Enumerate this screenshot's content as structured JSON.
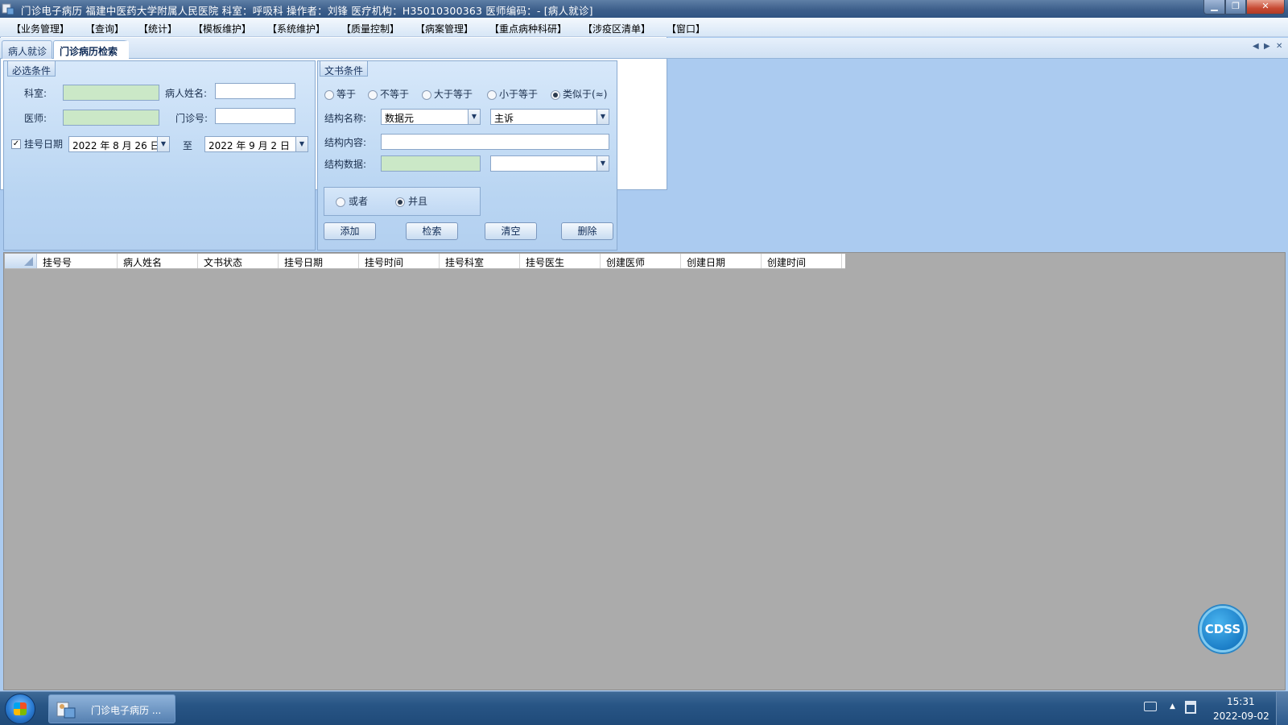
{
  "window": {
    "title": "门诊电子病历  福建中医药大学附属人民医院  科室：呼吸科  操作者：刘锋  医疗机构：H35010300363  医师编码：- [病人就诊]",
    "minimize": "▁",
    "maximize": "❐",
    "close": "✕"
  },
  "menu": [
    "【业务管理】",
    "【查询】",
    "【统计】",
    "【模板维护】",
    "【系统维护】",
    "【质量控制】",
    "【病案管理】",
    "【重点病种科研】",
    "【涉疫区清单】",
    "【窗口】"
  ],
  "tabs": {
    "items": [
      "病人就诊",
      "门诊病历检索"
    ],
    "active": "门诊病历检索",
    "ctrl_prev": "◀",
    "ctrl_next": "▶",
    "ctrl_close": "✕"
  },
  "required": {
    "title": "必选条件",
    "dept_label": "科室:",
    "dept_value": "",
    "patient_label": "病人姓名:",
    "patient_value": "",
    "doctor_label": "医师:",
    "doctor_value": "",
    "outpatient_label": "门诊号:",
    "outpatient_value": "",
    "reg_date_label": "挂号日期",
    "reg_date_checked": true,
    "date_from": "2022 年 8 月 26 日",
    "to_label": "至",
    "date_to": "2022 年 9 月 2 日"
  },
  "doc": {
    "title": "文书条件",
    "operators": [
      {
        "label": "等于",
        "checked": false
      },
      {
        "label": "不等于",
        "checked": false
      },
      {
        "label": "大于等于",
        "checked": false
      },
      {
        "label": "小于等于",
        "checked": false
      },
      {
        "label": "类似于(≈)",
        "checked": true
      }
    ],
    "struct_name_label": "结构名称:",
    "struct_name_value": "数据元",
    "struct_name_value2": "主诉",
    "content_label": "结构内容:",
    "content_value": "",
    "data_label": "结构数据:",
    "data_value": "",
    "data_value2": "",
    "logic": [
      {
        "label": "或者",
        "checked": false
      },
      {
        "label": "并且",
        "checked": true
      }
    ],
    "buttons": {
      "add": "添加",
      "search": "检索",
      "clear": "清空",
      "delete": "删除"
    }
  },
  "grid": {
    "columns": [
      "挂号号",
      "病人姓名",
      "文书状态",
      "挂号日期",
      "挂号时间",
      "挂号科室",
      "挂号医生",
      "创建医师",
      "创建日期",
      "创建时间"
    ],
    "rows": []
  },
  "cdss": {
    "label": "CDSS"
  },
  "taskbar": {
    "app_label": "门诊电子病历  ...",
    "time": "15:31",
    "date": "2022-09-02",
    "tray_up": "▲"
  },
  "colors": {
    "panel_bg": "#b9d5f2",
    "grid_bg": "#ababab",
    "taskbar": "#285585",
    "green_field": "#cbe8c7"
  }
}
